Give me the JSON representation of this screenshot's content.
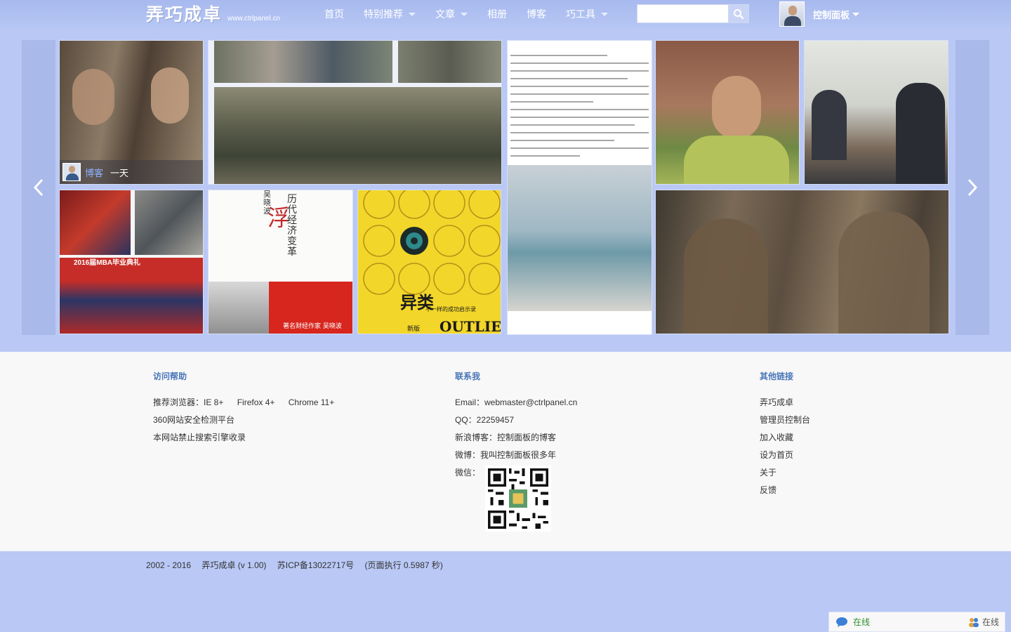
{
  "header": {
    "logo_text": "弄巧成卓",
    "logo_url": "www.ctrlpanel.cn",
    "nav": [
      {
        "label": "首页",
        "has_dropdown": false
      },
      {
        "label": "特别推荐",
        "has_dropdown": true
      },
      {
        "label": "文章",
        "has_dropdown": true
      },
      {
        "label": "相册",
        "has_dropdown": false
      },
      {
        "label": "博客",
        "has_dropdown": false
      },
      {
        "label": "巧工具",
        "has_dropdown": true
      }
    ],
    "search": {
      "placeholder": "",
      "value": "",
      "button_icon": "search-icon"
    },
    "user": {
      "name": "控制面板",
      "avatar": "avatar"
    }
  },
  "gallery": {
    "prev_icon": "chevron-left-icon",
    "next_icon": "chevron-right-icon",
    "featured_caption": {
      "category": "博客",
      "title": "一天"
    },
    "book_titles": {
      "book1": {
        "author": "吴晓波",
        "title_main": "浮",
        "title_sub": "历代经济变革",
        "footer": "著名财经作家 吴晓波"
      },
      "book2": {
        "title": "异类",
        "subtitle": "不一样的成功启示录",
        "edition": "新版",
        "english": "OUTLIERS"
      }
    },
    "photo_caption_small": "2016届MBA毕业典礼"
  },
  "footer": {
    "help": {
      "title": "访问帮助",
      "browsers": [
        "推荐浏览器：IE 8+",
        "Firefox 4+",
        "Chrome 11+"
      ],
      "lines": [
        "360网站安全检测平台",
        "本网站禁止搜索引擎收录"
      ]
    },
    "contact": {
      "title": "联系我",
      "lines": [
        "Email：webmaster@ctrlpanel.cn",
        "QQ：22259457",
        "新浪博客：控制面板的博客",
        "微博：我叫控制面板很多年"
      ],
      "wechat_label": "微信："
    },
    "links": {
      "title": "其他链接",
      "items": [
        "弄巧成卓",
        "管理员控制台",
        "加入收藏",
        "设为首页",
        "关于",
        "反馈"
      ]
    }
  },
  "copyright": {
    "years": "2002 - 2016",
    "site": "弄巧成卓 (v 1.00)",
    "icp": "苏ICP备13022717号",
    "exec": "(页面执行 0.5987 秒)"
  },
  "online_widget": {
    "chat_label": "在线",
    "people_label": "在线"
  },
  "colors": {
    "accent": "#4a76b8",
    "header_bg": "#a7b9ee",
    "page_bg": "#b9c8f5",
    "footer_bg": "#f8f8f8"
  }
}
